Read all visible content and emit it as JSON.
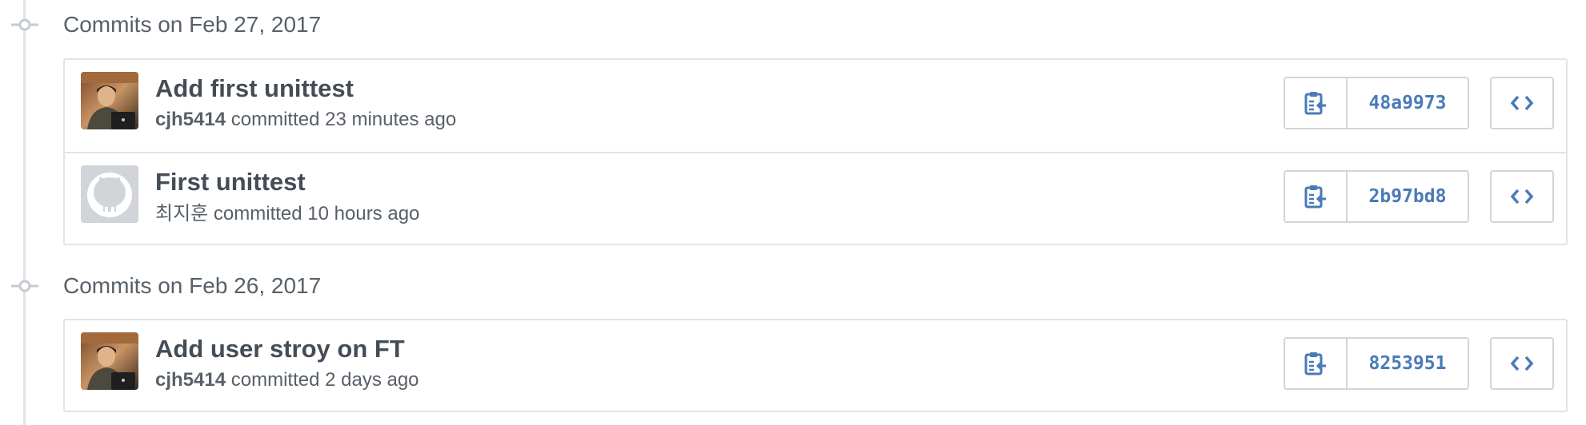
{
  "groups": [
    {
      "title": "Commits on Feb 27, 2017",
      "commits": [
        {
          "title": "Add first unittest",
          "author": "cjh5414",
          "action": " committed 23 minutes ago",
          "sha": "48a9973",
          "avatar": "user-photo"
        },
        {
          "title": "First unittest",
          "author": "최지훈",
          "action": " committed 10 hours ago",
          "sha": "2b97bd8",
          "avatar": "github-octocat-default"
        }
      ]
    },
    {
      "title": "Commits on Feb 26, 2017",
      "commits": [
        {
          "title": "Add user stroy on FT",
          "author": "cjh5414",
          "action": " committed 2 days ago",
          "sha": "8253951",
          "avatar": "user-photo"
        }
      ]
    }
  ],
  "icons": {
    "copy": "clippy-icon",
    "browse": "code-icon",
    "timeline": "git-commit-icon"
  },
  "colors": {
    "sha_link": "#4a7ab8",
    "border": "#e1e4e8",
    "muted_text": "#586069",
    "title_text": "#444d56"
  }
}
